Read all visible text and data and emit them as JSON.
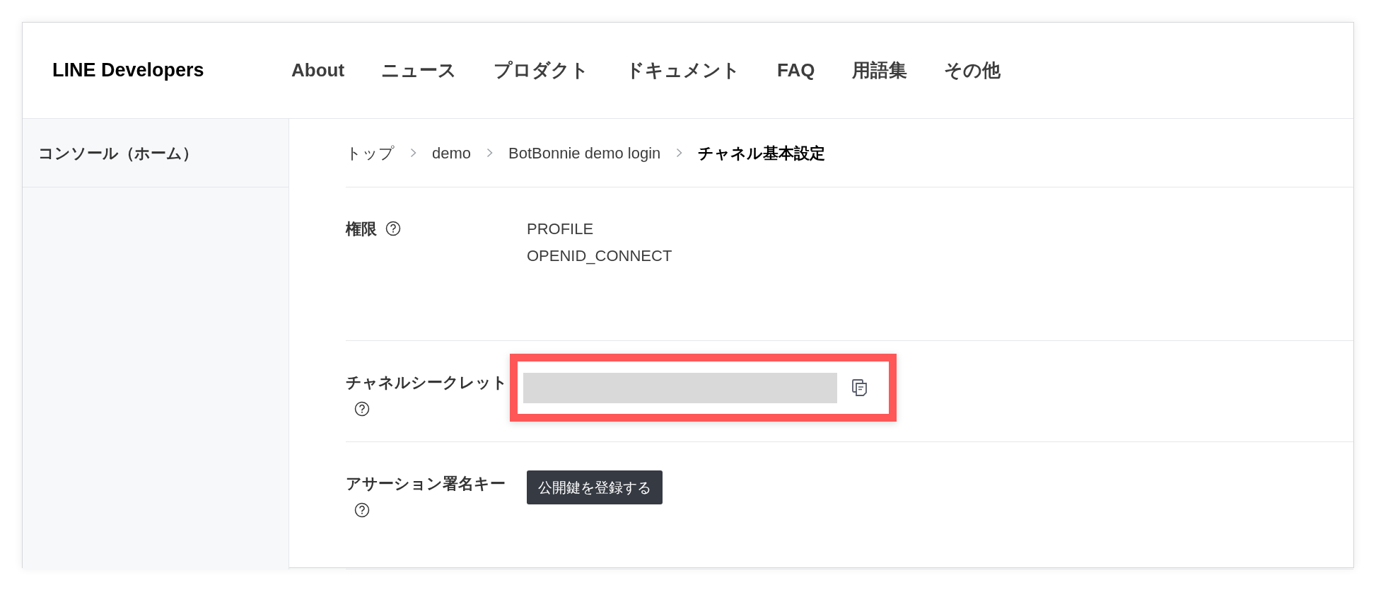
{
  "header": {
    "logo": "LINE Developers",
    "nav": [
      {
        "label": "About"
      },
      {
        "label": "ニュース"
      },
      {
        "label": "プロダクト"
      },
      {
        "label": "ドキュメント"
      },
      {
        "label": "FAQ"
      },
      {
        "label": "用語集"
      },
      {
        "label": "その他"
      }
    ]
  },
  "sidebar": {
    "items": [
      {
        "label": "コンソール（ホーム）"
      }
    ]
  },
  "breadcrumb": [
    {
      "label": "トップ",
      "current": false
    },
    {
      "label": "demo",
      "current": false
    },
    {
      "label": "BotBonnie demo login",
      "current": false
    },
    {
      "label": "チャネル基本設定",
      "current": true
    }
  ],
  "sections": [
    {
      "kind": "list",
      "label": "権限",
      "values": [
        "PROFILE",
        "OPENID_CONNECT"
      ]
    },
    {
      "kind": "secret",
      "label": "チャネルシークレット",
      "highlighted": true
    },
    {
      "kind": "button",
      "label": "アサーション署名キー",
      "button": "公開鍵を登録する"
    }
  ]
}
